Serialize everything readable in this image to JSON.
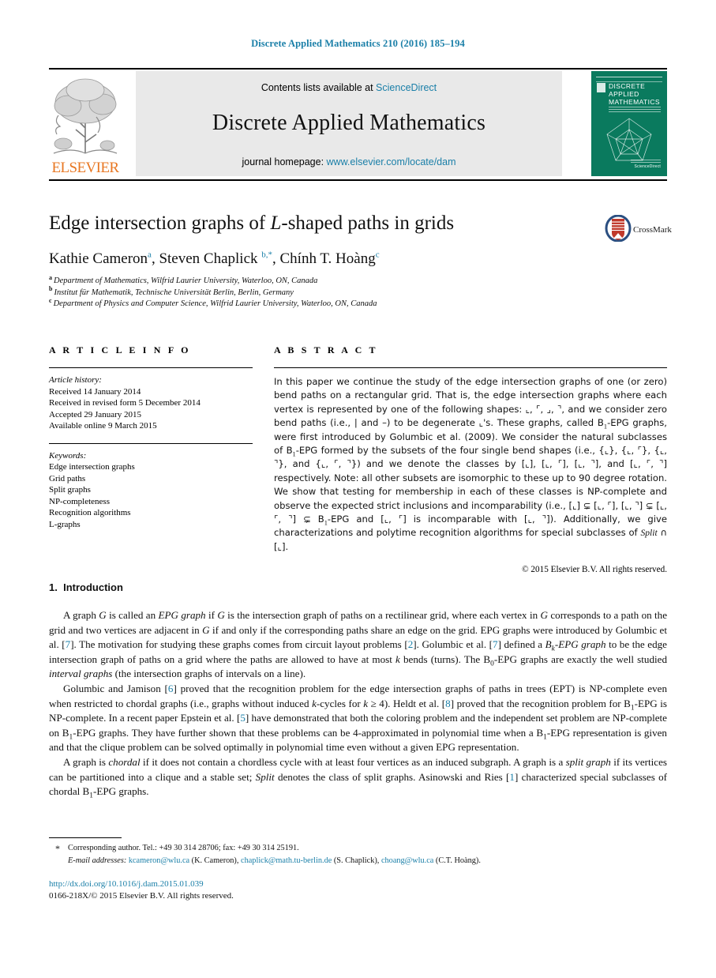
{
  "running_head": "Discrete Applied Mathematics 210 (2016) 185–194",
  "banner": {
    "publisher_name": "ELSEVIER",
    "contents_prefix": "Contents lists available at ",
    "contents_link": "ScienceDirect",
    "journal_title": "Discrete Applied Mathematics",
    "homepage_prefix": "journal homepage: ",
    "homepage_url": "www.elsevier.com/locate/dam",
    "cover": {
      "line1": "DISCRETE",
      "line2": "APPLIED",
      "line3": "MATHEMATICS",
      "footer": "ScienceDirect",
      "color": "#0a7a5e"
    }
  },
  "article": {
    "title_part1": "Edge intersection graphs of ",
    "title_italic": "L",
    "title_part2": "-shaped paths in grids",
    "crossmark_label": "CrossMark",
    "authors": [
      {
        "name": "Kathie Cameron",
        "sup": "a"
      },
      {
        "name": "Steven Chaplick",
        "sup": "b,*"
      },
      {
        "name": "Chính T. Hoàng",
        "sup": "c"
      }
    ],
    "affiliations": [
      {
        "marker": "a",
        "text": "Department of Mathematics, Wilfrid Laurier University, Waterloo, ON, Canada"
      },
      {
        "marker": "b",
        "text": "Institut für Mathematik, Technische Universität Berlin, Berlin, Germany"
      },
      {
        "marker": "c",
        "text": "Department of Physics and Computer Science, Wilfrid Laurier University, Waterloo, ON, Canada"
      }
    ]
  },
  "article_info": {
    "heading": "A R T I C L E   I N F O",
    "history_label": "Article history:",
    "history": [
      "Received 14 January 2014",
      "Received in revised form 5 December 2014",
      "Accepted 29 January 2015",
      "Available online 9 March 2015"
    ],
    "keywords_label": "Keywords:",
    "keywords": [
      "Edge intersection graphs",
      "Grid paths",
      "Split graphs",
      "NP-completeness",
      "Recognition algorithms",
      "L-graphs"
    ]
  },
  "abstract": {
    "heading": "A B S T R A C T",
    "text_p1": "In this paper we continue the study of the edge intersection graphs of one (or zero) bend paths on a rectangular grid. That is, the edge intersection graphs where each vertex is represented by one of the following shapes: ⌞, ⌜, ⌟, ⌝, and we consider zero bend paths (i.e., | and –) to be degenerate ⌞'s. These graphs, called B",
    "text_p1b": "-EPG graphs, were first introduced by Golumbic et al. (2009). We consider the natural subclasses of B",
    "text_p1c": "-EPG formed by the subsets of the four single bend shapes (i.e., {⌞}, {⌞, ⌜}, {⌞, ⌝}, and {⌞, ⌜, ⌝}) and we denote the classes by [⌞], [⌞, ⌜], [⌞, ⌝], and [⌞, ⌜, ⌝] respectively. Note: all other subsets are isomorphic to these up to 90 degree rotation. We show that testing for membership in each of these classes is NP-complete and observe the expected strict inclusions and incomparability (i.e., [⌞] ⊊ [⌞, ⌜], [⌞, ⌝] ⊊ [⌞, ⌜, ⌝] ⊊ B",
    "text_p1d": "-EPG and [⌞, ⌜] is incomparable with [⌞, ⌝]). Additionally, we give characterizations and polytime recognition algorithms for special subclasses of ",
    "text_split": "Split",
    "text_p1e": " ∩ [⌞].",
    "sub": "1",
    "copyright": "© 2015 Elsevier B.V. All rights reserved."
  },
  "introduction": {
    "number": "1.",
    "heading": "Introduction",
    "para1_a": "A graph ",
    "para1_G": "G",
    "para1_b": " is called an ",
    "para1_epg": "EPG graph",
    "para1_c": " if ",
    "para1_d": " is the intersection graph of paths on a rectilinear grid, where each vertex in ",
    "para1_e": " corresponds to a path on the grid and two vertices are adjacent in ",
    "para1_f": " if and only if the corresponding paths share an edge on the grid. EPG graphs were introduced by Golumbic et al. [",
    "ref7": "7",
    "para1_g": "]. The motivation for studying these graphs comes from circuit layout problems [",
    "ref2": "2",
    "para1_h": "]. Golumbic et al. [",
    "para1_i": "] defined a ",
    "para1_bk": "B",
    "para1_bk_sub": "k",
    "para1_bk_rest": "-EPG graph",
    "para1_j": " to be the edge intersection graph of paths on a grid where the paths are allowed to have at most ",
    "para1_k": "k",
    "para1_l": " bends (turns). The B",
    "para1_zero": "0",
    "para1_m": "-EPG graphs are exactly the well studied ",
    "para1_interval": "interval graphs",
    "para1_n": " (the intersection graphs of intervals on a line).",
    "para2_a": "Golumbic and Jamison [",
    "ref6": "6",
    "para2_b": "] proved that the recognition problem for the edge intersection graphs of paths in trees (EPT) is NP-complete even when restricted to chordal graphs (i.e., graphs without induced ",
    "para2_kcycles": "k",
    "para2_c": "-cycles for ",
    "para2_d": " ≥ 4). Heldt et al. [",
    "ref8": "8",
    "para2_e": "] proved that the recognition problem for B",
    "para2_one": "1",
    "para2_f": "-EPG is NP-complete. In a recent paper Epstein et al. [",
    "ref5": "5",
    "para2_g": "] have demonstrated that both the coloring problem and the independent set problem are NP-complete on B",
    "para2_h": "-EPG graphs. They have further shown that these problems can be 4-approximated in polynomial time when a B",
    "para2_i": "-EPG representation is given and that the clique problem can be solved optimally in polynomial time even without a given EPG representation.",
    "para3_a": "A graph is ",
    "para3_chordal": "chordal",
    "para3_b": " if it does not contain a chordless cycle with at least four vertices as an induced subgraph. A graph is a ",
    "para3_split": "split graph",
    "para3_c": " if its vertices can be partitioned into a clique and a stable set; ",
    "para3_splitital": "Split",
    "para3_d": " denotes the class of split graphs. Asinowski and Ries [",
    "ref1": "1",
    "para3_e": "] characterized special subclasses of chordal B",
    "para3_f": "-EPG graphs."
  },
  "footnotes": {
    "star": "*",
    "corresponding": "Corresponding author. Tel.: +49 30 314 28706; fax: +49 30 314 25191.",
    "email_label": "E-mail addresses:",
    "emails": [
      {
        "address": "kcameron@wlu.ca",
        "owner": "(K. Cameron)"
      },
      {
        "address": "chaplick@math.tu-berlin.de",
        "owner": "(S. Chaplick)"
      },
      {
        "address": "choang@wlu.ca",
        "owner": "(C.T. Hoàng)"
      }
    ],
    "doi": "http://dx.doi.org/10.1016/j.dam.2015.01.039",
    "issn": "0166-218X/© 2015 Elsevier B.V. All rights reserved."
  },
  "colors": {
    "link": "#1a7fa8",
    "elsevier_orange": "#e87722",
    "cover_green": "#0a7a5e"
  }
}
